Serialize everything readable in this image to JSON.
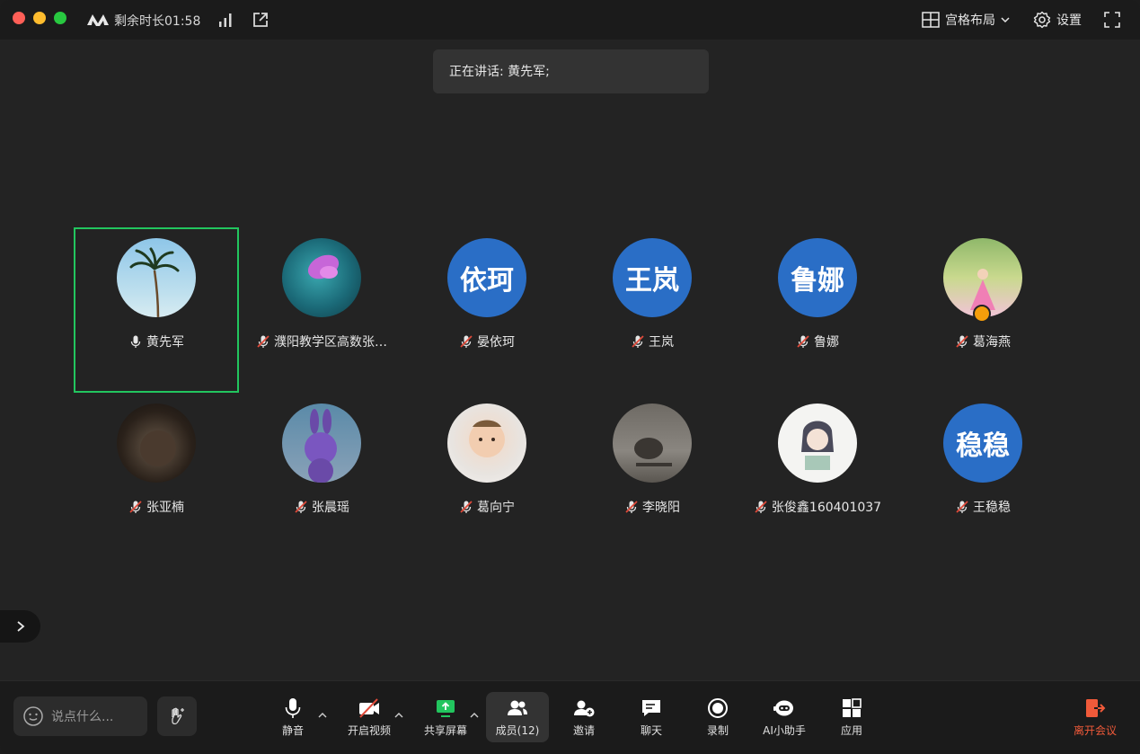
{
  "titlebar": {
    "timer": "剩余时长01:58",
    "layout_label": "宫格布局",
    "settings_label": "设置"
  },
  "speaking": {
    "text": "正在讲话: 黄先军;"
  },
  "participants": [
    {
      "name": "黄先军",
      "mic": "on",
      "avatar_text": "",
      "active": true
    },
    {
      "name": "濮阳教学区高数张…",
      "mic": "muted",
      "avatar_text": ""
    },
    {
      "name": "晏依珂",
      "mic": "muted",
      "avatar_text": "依珂"
    },
    {
      "name": "王岚",
      "mic": "muted",
      "avatar_text": "王岚"
    },
    {
      "name": "鲁娜",
      "mic": "muted",
      "avatar_text": "鲁娜"
    },
    {
      "name": "葛海燕",
      "mic": "muted",
      "avatar_text": ""
    },
    {
      "name": "张亚楠",
      "mic": "muted",
      "avatar_text": ""
    },
    {
      "name": "张晨瑶",
      "mic": "muted",
      "avatar_text": ""
    },
    {
      "name": "葛向宁",
      "mic": "muted",
      "avatar_text": ""
    },
    {
      "name": "李晓阳",
      "mic": "muted",
      "avatar_text": ""
    },
    {
      "name": "张俊鑫160401037",
      "mic": "muted",
      "avatar_text": ""
    },
    {
      "name": "王稳稳",
      "mic": "muted",
      "avatar_text": "稳稳"
    }
  ],
  "toolbar": {
    "chat_placeholder": "说点什么...",
    "mute_label": "静音",
    "video_label": "开启视频",
    "share_label": "共享屏幕",
    "members_label": "成员(12)",
    "invite_label": "邀请",
    "chat_label": "聊天",
    "record_label": "录制",
    "ai_label": "AI小助手",
    "apps_label": "应用",
    "leave_label": "离开会议"
  },
  "colors": {
    "active_border": "#22c55e",
    "avatar_blue": "#2a6ec6",
    "leave_red": "#f05a3a",
    "share_green": "#22c55e"
  }
}
